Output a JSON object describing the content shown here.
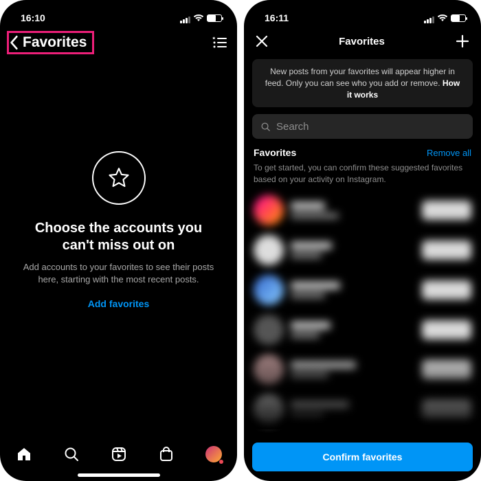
{
  "left": {
    "time": "16:10",
    "header_title": "Favorites",
    "empty_heading": "Choose the accounts you can't miss out on",
    "empty_body": "Add accounts to your favorites to see their posts here, starting with the most recent posts.",
    "add_favorites": "Add favorites"
  },
  "right": {
    "time": "16:11",
    "header_title": "Favorites",
    "info_line": "New posts from your favorites will appear higher in feed. Only you can see who you add or remove. ",
    "info_link": "How it works",
    "search_placeholder": "Search",
    "section_title": "Favorites",
    "remove_all": "Remove all",
    "hint": "To get started, you can confirm these suggested favorites based on your activity on Instagram.",
    "confirm_label": "Confirm favorites"
  }
}
